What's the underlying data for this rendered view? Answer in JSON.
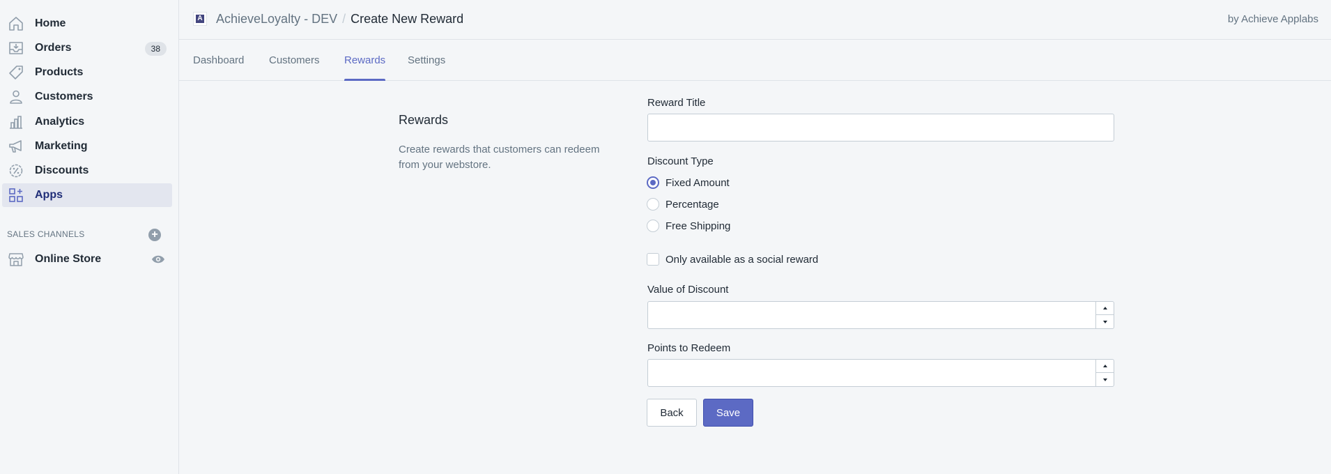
{
  "sidebar": {
    "items": [
      {
        "label": "Home",
        "icon": "home-icon"
      },
      {
        "label": "Orders",
        "icon": "orders-icon",
        "badge": "38"
      },
      {
        "label": "Products",
        "icon": "tag-icon"
      },
      {
        "label": "Customers",
        "icon": "person-icon"
      },
      {
        "label": "Analytics",
        "icon": "bar-chart-icon"
      },
      {
        "label": "Marketing",
        "icon": "megaphone-icon"
      },
      {
        "label": "Discounts",
        "icon": "discount-icon"
      },
      {
        "label": "Apps",
        "icon": "apps-icon",
        "active": true
      }
    ],
    "sales_channels": {
      "heading": "SALES CHANNELS",
      "add_symbol": "+",
      "items": [
        {
          "label": "Online Store",
          "icon": "store-icon"
        }
      ]
    }
  },
  "header": {
    "logo_letter": "A",
    "app_name": "AchieveLoyalty - DEV",
    "separator": "/",
    "page": "Create New Reward",
    "byline": "by Achieve Applabs"
  },
  "tabs": [
    {
      "label": "Dashboard"
    },
    {
      "label": "Customers"
    },
    {
      "label": "Rewards",
      "active": true
    },
    {
      "label": "Settings"
    }
  ],
  "form_section": {
    "title": "Rewards",
    "description": "Create rewards that customers can redeem from your webstore."
  },
  "form": {
    "reward_title": {
      "label": "Reward Title",
      "value": ""
    },
    "discount_type": {
      "label": "Discount Type",
      "options": [
        "Fixed Amount",
        "Percentage",
        "Free Shipping"
      ],
      "selected": "Fixed Amount"
    },
    "social_reward": {
      "label": "Only available as a social reward",
      "checked": false
    },
    "value_of_discount": {
      "label": "Value of Discount",
      "value": ""
    },
    "points_to_redeem": {
      "label": "Points to Redeem",
      "value": ""
    },
    "back_label": "Back",
    "save_label": "Save"
  },
  "colors": {
    "accent": "#5c6ac4",
    "active_nav_bg": "#e3e6ef",
    "background": "#f4f6f8"
  }
}
